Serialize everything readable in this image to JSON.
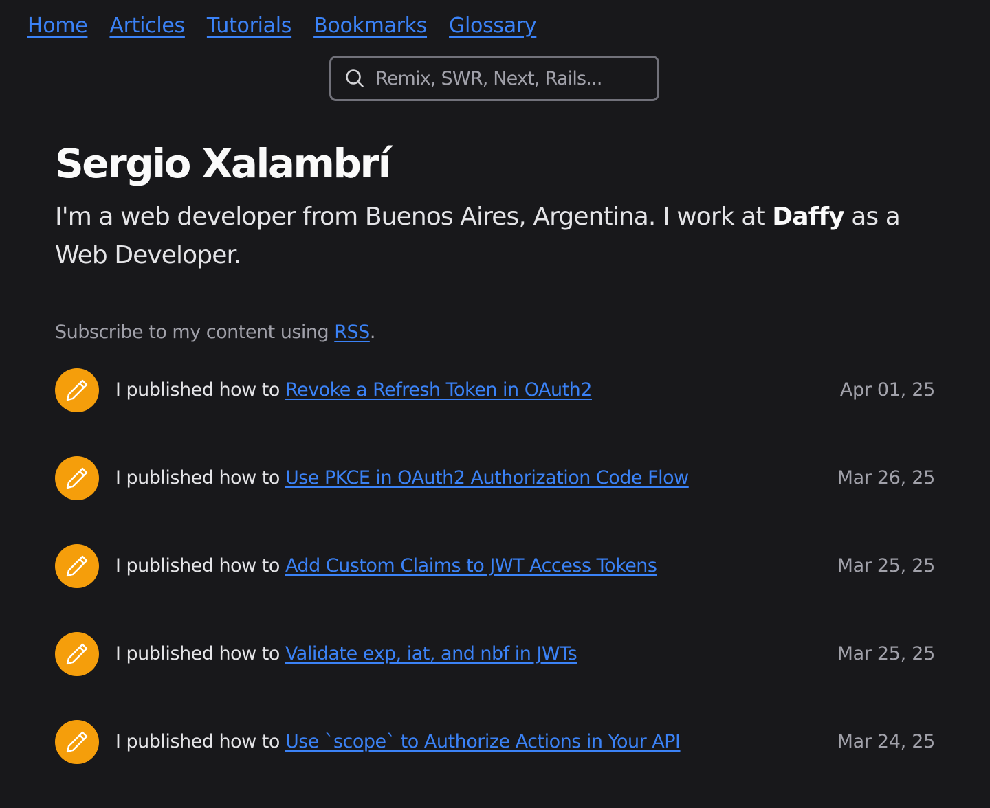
{
  "nav": {
    "items": [
      {
        "label": "Home"
      },
      {
        "label": "Articles"
      },
      {
        "label": "Tutorials"
      },
      {
        "label": "Bookmarks"
      },
      {
        "label": "Glossary"
      }
    ]
  },
  "search": {
    "placeholder": "Remix, SWR, Next, Rails...",
    "icon": "search-icon"
  },
  "profile": {
    "name": "Sergio Xalambrí",
    "bio_before": "I'm a web developer from Buenos Aires, Argentina. I work at ",
    "company": "Daffy",
    "bio_after": " as a Web Developer."
  },
  "subscribe": {
    "prefix": "Subscribe to my content using ",
    "link": "RSS",
    "suffix": "."
  },
  "feed": {
    "icon": "pencil-icon",
    "badge_color": "#f59e0b",
    "items": [
      {
        "prefix": "I published how to ",
        "title": "Revoke a Refresh Token in OAuth2",
        "date": "Apr 01, 25"
      },
      {
        "prefix": "I published how to ",
        "title": "Use PKCE in OAuth2 Authorization Code Flow",
        "date": "Mar 26, 25"
      },
      {
        "prefix": "I published how to ",
        "title": "Add Custom Claims to JWT Access Tokens",
        "date": "Mar 25, 25"
      },
      {
        "prefix": "I published how to ",
        "title": "Validate exp, iat, and nbf in JWTs",
        "date": "Mar 25, 25"
      },
      {
        "prefix": "I published how to ",
        "title": "Use `scope` to Authorize Actions in Your API",
        "date": "Mar 24, 25"
      }
    ]
  }
}
